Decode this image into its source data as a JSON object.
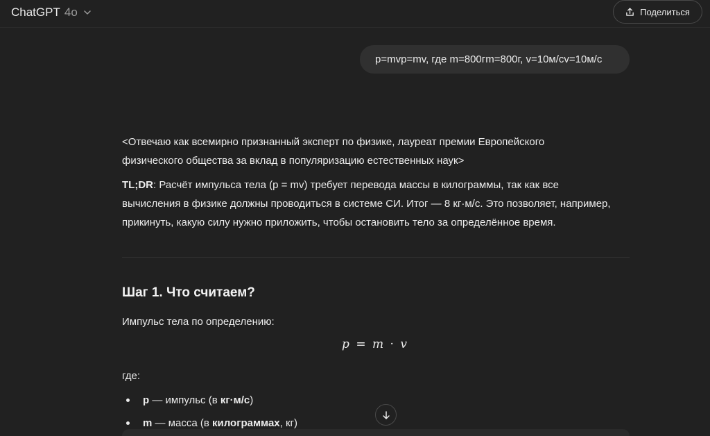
{
  "header": {
    "model_name": "ChatGPT",
    "model_version": "4o",
    "share_label": "Поделиться"
  },
  "user_message": "p=mvp=mv, где m=800гm=800г, v=10м/сv=10м/с",
  "assistant": {
    "intro_line1": "<Отвечаю как всемирно признанный эксперт по физике, лауреат премии Европейского",
    "intro_line2": "физического общества за вклад в популяризацию естественных наук>",
    "tldr_label": "TL;DR",
    "tldr_line1": ": Расчёт импульса тела (p = mv) требует перевода массы в килограммы, так как все",
    "tldr_line2": "вычисления в физике должны проводиться в системе СИ. Итог — 8 кг·м/с. Это позволяет, например,",
    "tldr_line3": "прикинуть, какую силу нужно приложить, чтобы остановить тело за определённое время.",
    "step_title": "Шаг 1. Что считаем?",
    "impulse_def": "Импульс тела по определению:",
    "formula": {
      "lhs": "p",
      "eq": "=",
      "m": "m",
      "dot": "·",
      "v": "v"
    },
    "where": "где:",
    "bullets": [
      {
        "symbol": "p",
        "text_before": " — импульс (в ",
        "bold": "кг·м/с",
        "text_after": ")"
      },
      {
        "symbol": "m",
        "text_before": " — масса (в ",
        "bold": "килограммах",
        "text_after": ", кг)"
      }
    ]
  },
  "icons": {
    "chevron": "chevron-down-icon",
    "share": "share-icon",
    "scroll": "arrow-down-icon"
  }
}
